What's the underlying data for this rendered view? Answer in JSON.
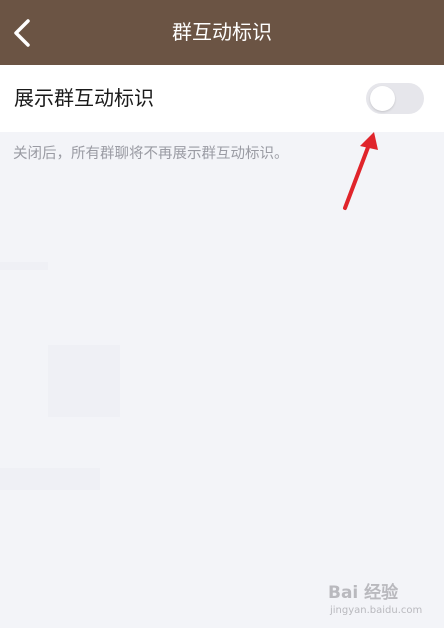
{
  "header": {
    "title": "群互动标识",
    "back_icon": "chevron-left-icon",
    "background": "#6b5444"
  },
  "setting": {
    "label": "展示群互动标识",
    "toggle_on": false
  },
  "description": "关闭后，所有群聊将不再展示群互动标识。",
  "annotation": {
    "arrow_color": "#e0242b"
  },
  "watermark": {
    "brand": "Bai 经验",
    "url": "jingyan.baidu.com"
  }
}
